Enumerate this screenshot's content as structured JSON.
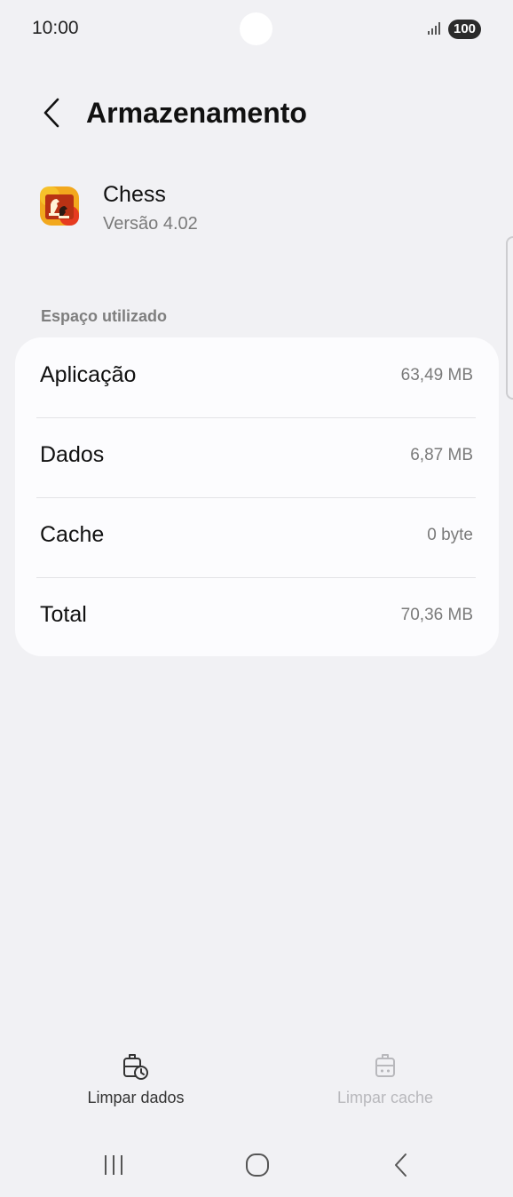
{
  "status_bar": {
    "time": "10:00",
    "battery": "100",
    "signal_icon": "signal-bars-icon"
  },
  "header": {
    "back_icon": "back-chevron-icon",
    "title": "Armazenamento"
  },
  "app": {
    "name": "Chess",
    "version": "Versão 4.02",
    "icon": "chess-app-icon"
  },
  "section": {
    "label": "Espaço utilizado"
  },
  "storage": {
    "rows": [
      {
        "label": "Aplicação",
        "value": "63,49 MB"
      },
      {
        "label": "Dados",
        "value": "6,87 MB"
      },
      {
        "label": "Cache",
        "value": "0 byte"
      },
      {
        "label": "Total",
        "value": "70,36 MB"
      }
    ]
  },
  "actions": {
    "clear_data": {
      "label": "Limpar dados",
      "icon": "clear-data-icon",
      "enabled": true
    },
    "clear_cache": {
      "label": "Limpar cache",
      "icon": "clear-cache-icon",
      "enabled": false
    }
  },
  "nav": {
    "recents_icon": "recents-icon",
    "home_icon": "home-icon",
    "back_icon": "back-icon"
  },
  "colors": {
    "background": "#f1f1f4",
    "card": "#fcfcfe",
    "secondary_text": "#7a7a7a",
    "disabled_text": "#b8b8bc"
  }
}
